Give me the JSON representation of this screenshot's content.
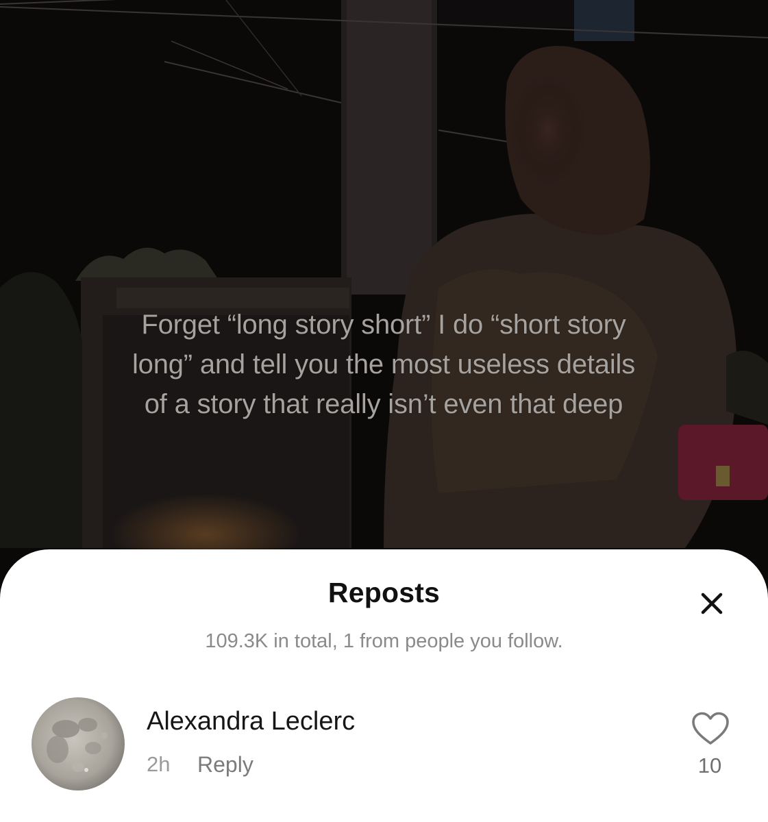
{
  "video": {
    "caption": "Forget “long story short” I do “short story long” and tell you the most useless details of a story that really isn’t even that deep"
  },
  "sheet": {
    "title": "Reposts",
    "subtitle": "109.3K in total, 1 from people you follow.",
    "close_icon": "close-icon"
  },
  "reposts": [
    {
      "name": "Alexandra Leclerc",
      "time": "2h",
      "reply_label": "Reply",
      "like_count": "10",
      "avatar_icon": "moon-avatar",
      "like_icon": "heart-outline-icon"
    }
  ],
  "colors": {
    "sheet_bg": "#ffffff",
    "title": "#111111",
    "subtitle": "#8a8a8a",
    "caption": "#a5a29f",
    "video_bg": "#0b0908"
  }
}
